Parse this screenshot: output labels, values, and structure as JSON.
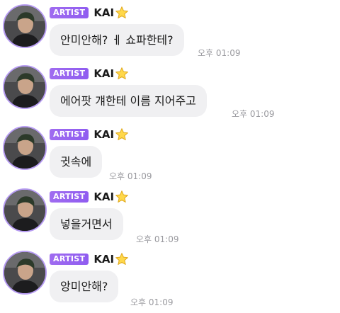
{
  "artist": {
    "badge": "ARTIST",
    "name": "KAI",
    "star_icon": "star-icon",
    "accent_color": "#9b67f0"
  },
  "messages": [
    {
      "text": "안미안해? ㅔ 쇼파한테?",
      "time": "오후 01:09"
    },
    {
      "text": "에어팟 걔한테 이름 지어주고",
      "time": "오후 01:09"
    },
    {
      "text": "귓속에",
      "time": "오후 01:09"
    },
    {
      "text": "넣을거면서",
      "time": "오후 01:09"
    },
    {
      "text": "앙미안해?",
      "time": "오후 01:09"
    }
  ]
}
